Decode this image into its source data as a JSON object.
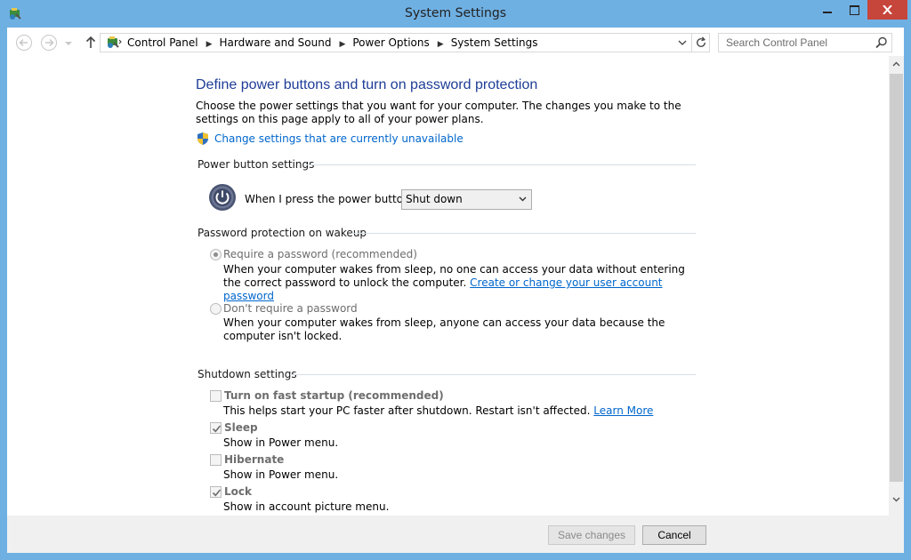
{
  "window": {
    "title": "System Settings",
    "accent": "#6fb0e3",
    "close_color": "#c7463b"
  },
  "nav": {
    "back_icon": "back-arrow-icon",
    "forward_icon": "forward-arrow-icon",
    "up_icon": "up-arrow-icon",
    "breadcrumbs": [
      "Control Panel",
      "Hardware and Sound",
      "Power Options",
      "System Settings"
    ],
    "search_placeholder": "Search Control Panel"
  },
  "page": {
    "heading": "Define power buttons and turn on password protection",
    "intro": "Choose the power settings that you want for your computer. The changes you make to the settings on this page apply to all of your power plans.",
    "change_settings_link": "Change settings that are currently unavailable"
  },
  "power_buttons": {
    "group_title": "Power button settings",
    "label": "When I press the power button:",
    "selected_action": "Shut down"
  },
  "password": {
    "group_title": "Password protection on wakeup",
    "require_label": "Require a password (recommended)",
    "require_checked": true,
    "require_desc": "When your computer wakes from sleep, no one can access your data without entering the correct password to unlock the computer.",
    "require_link": "Create or change your user account password",
    "dont_require_label": "Don't require a password",
    "dont_require_checked": false,
    "dont_require_desc": "When your computer wakes from sleep, anyone can access your data because the computer isn't locked."
  },
  "shutdown": {
    "group_title": "Shutdown settings",
    "items": [
      {
        "label": "Turn on fast startup (recommended)",
        "checked": false,
        "desc": "This helps start your PC faster after shutdown. Restart isn't affected.",
        "link": "Learn More"
      },
      {
        "label": "Sleep",
        "checked": true,
        "desc": "Show in Power menu."
      },
      {
        "label": "Hibernate",
        "checked": false,
        "desc": "Show in Power menu."
      },
      {
        "label": "Lock",
        "checked": true,
        "desc": "Show in account picture menu."
      }
    ]
  },
  "buttons": {
    "save": "Save changes",
    "cancel": "Cancel"
  }
}
